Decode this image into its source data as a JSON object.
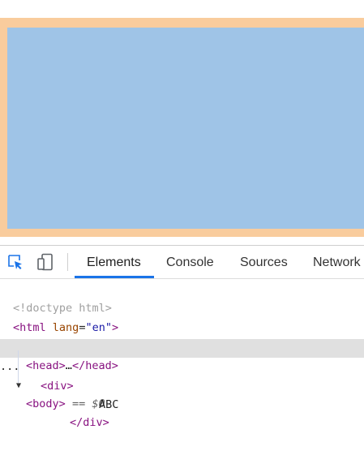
{
  "viewport": {
    "colors": {
      "margin": "#f9cc9d",
      "content": "#9fc4e7"
    }
  },
  "devtools": {
    "tools": [
      {
        "name": "inspect-element-icon"
      },
      {
        "name": "device-toggle-icon"
      }
    ],
    "tabs": [
      {
        "label": "Elements",
        "active": true
      },
      {
        "label": "Console"
      },
      {
        "label": "Sources"
      },
      {
        "label": "Network"
      }
    ],
    "dom": {
      "doctype": "<!doctype html>",
      "html_tag": "html",
      "html_attr": "lang",
      "html_attr_value": "\"en\"",
      "head_tag": "head",
      "head_ellipsis": "…",
      "body_tag": "body",
      "body_marker": "== $0",
      "ellipsis": "...",
      "div_tag": "div",
      "div_text": "ABC"
    },
    "colors": {
      "accent": "#1a73e8",
      "tag": "#881280",
      "attr": "#994500",
      "value": "#1a1aa6"
    }
  }
}
